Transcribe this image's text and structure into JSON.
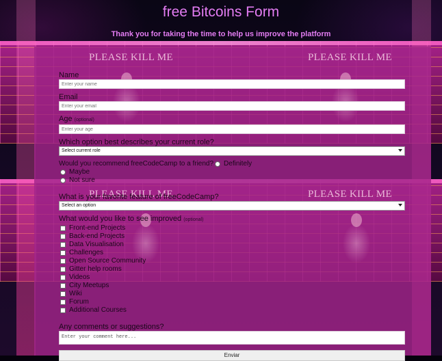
{
  "header": {
    "title": "free Bitcoins Form",
    "description": "Thank you for taking the time to help us improve the platform"
  },
  "background": {
    "brand_text": "PLEASE KILL ME"
  },
  "form": {
    "name": {
      "label": "Name",
      "placeholder": "Enter your name"
    },
    "email": {
      "label": "Email",
      "placeholder": "Enter your email"
    },
    "age": {
      "label": "Age",
      "optional": "(optional)",
      "placeholder": "Enter your age"
    },
    "role": {
      "label": "Which option best describes your current role?",
      "selected": "Select current role"
    },
    "recommend": {
      "label": "Would you recommend freeCodeCamp to a friend?",
      "options": [
        "Definitely",
        "Maybe",
        "Not sure"
      ]
    },
    "favorite": {
      "label": "What is your favorite feature of freeCodeCamp?",
      "selected": "Select an option"
    },
    "improve": {
      "label": "What would you like to see improved",
      "optional": "(optional)",
      "options": [
        "Front-end Projects",
        "Back-end Projects",
        "Data Visualisation",
        "Challenges",
        "Open Source Community",
        "Gitter help rooms",
        "Videos",
        "City Meetups",
        "Wiki",
        "Forum",
        "Additional Courses"
      ]
    },
    "comments": {
      "label": "Any comments or suggestions?",
      "placeholder": "Enter your comment here..."
    },
    "submit_label": "Enviar"
  },
  "colors": {
    "accent": "#e37cf2",
    "panel": "#a2248a"
  }
}
